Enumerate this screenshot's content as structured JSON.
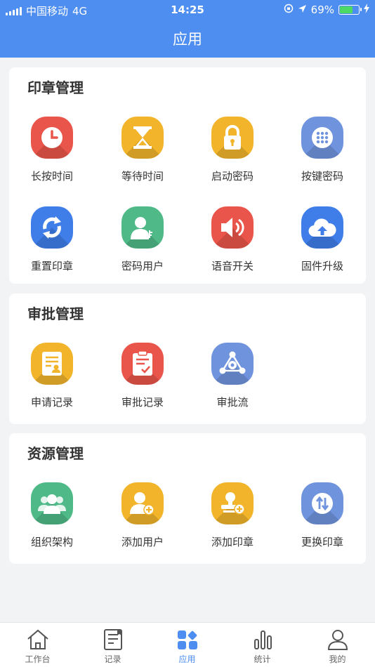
{
  "status_bar": {
    "carrier": "中国移动",
    "network": "4G",
    "time": "14:25",
    "battery": "69%"
  },
  "header": {
    "title": "应用"
  },
  "sections": [
    {
      "title": "印章管理",
      "items": [
        {
          "label": "长按时间",
          "icon": "clock-icon",
          "color": "#e9554a"
        },
        {
          "label": "等待时间",
          "icon": "hourglass-icon",
          "color": "#f1b42b"
        },
        {
          "label": "启动密码",
          "icon": "lock-icon",
          "color": "#f1b42b"
        },
        {
          "label": "按键密码",
          "icon": "keypad-icon",
          "color": "#6f93dd"
        },
        {
          "label": "重置印章",
          "icon": "reset-icon",
          "color": "#3f7ee8"
        },
        {
          "label": "密码用户",
          "icon": "user-key-icon",
          "color": "#4fb987"
        },
        {
          "label": "语音开关",
          "icon": "speaker-icon",
          "color": "#e9554a"
        },
        {
          "label": "固件升级",
          "icon": "cloud-upload-icon",
          "color": "#3f7ee8"
        }
      ]
    },
    {
      "title": "审批管理",
      "items": [
        {
          "label": "申请记录",
          "icon": "application-record-icon",
          "color": "#f1b42b"
        },
        {
          "label": "审批记录",
          "icon": "approval-record-icon",
          "color": "#e9554a"
        },
        {
          "label": "审批流",
          "icon": "approval-flow-icon",
          "color": "#6f93dd"
        }
      ]
    },
    {
      "title": "资源管理",
      "items": [
        {
          "label": "组织架构",
          "icon": "organization-icon",
          "color": "#4fb987"
        },
        {
          "label": "添加用户",
          "icon": "add-user-icon",
          "color": "#f1b42b"
        },
        {
          "label": "添加印章",
          "icon": "add-seal-icon",
          "color": "#f1b42b"
        },
        {
          "label": "更换印章",
          "icon": "swap-seal-icon",
          "color": "#6f93dd"
        }
      ]
    }
  ],
  "tabs": [
    {
      "label": "工作台",
      "icon": "home-icon",
      "active": false
    },
    {
      "label": "记录",
      "icon": "record-icon",
      "active": false
    },
    {
      "label": "应用",
      "icon": "apps-icon",
      "active": true
    },
    {
      "label": "统计",
      "icon": "stats-icon",
      "active": false
    },
    {
      "label": "我的",
      "icon": "profile-icon",
      "active": false
    }
  ]
}
